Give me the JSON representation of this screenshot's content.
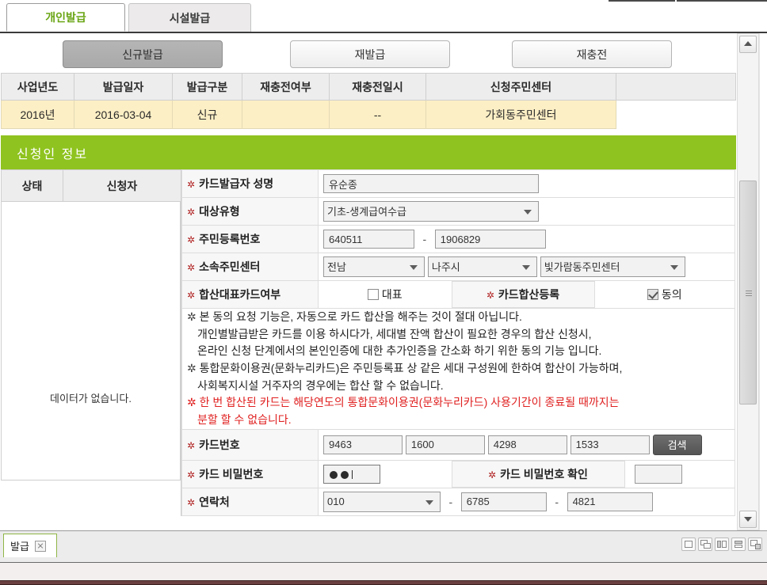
{
  "tabs": [
    {
      "label": "개인발급",
      "active": true
    },
    {
      "label": "시설발급",
      "active": false
    }
  ],
  "action_buttons": [
    {
      "label": "신규발급",
      "selected": true
    },
    {
      "label": "재발급",
      "selected": false
    },
    {
      "label": "재충전",
      "selected": false
    }
  ],
  "summary_grid": {
    "headers": [
      "사업년도",
      "발급일자",
      "발급구분",
      "재충전여부",
      "재충전일시",
      "신청주민센터",
      ""
    ],
    "rows": [
      [
        "2016년",
        "2016-03-04",
        "신규",
        "",
        "--",
        "가회동주민센터",
        ""
      ]
    ]
  },
  "section": {
    "title": "신청인 정보"
  },
  "left_list": {
    "headers": [
      "상태",
      "신청자"
    ],
    "empty_message": "데이터가 없습니다."
  },
  "form": {
    "name": {
      "label": "카드발급자 성명",
      "value": "유순종"
    },
    "target_type": {
      "label": "대상유형",
      "value": "기초-생계급여수급"
    },
    "resident_number": {
      "label": "주민등록번호",
      "front": "640511",
      "separator": "-",
      "back": "1906829"
    },
    "center": {
      "label": "소속주민센터",
      "province": "전남",
      "city": "나주시",
      "dong": "빛가람동주민센터"
    },
    "merge_rep": {
      "label": "합산대표카드여부",
      "checkbox_label": "대표",
      "checked": false
    },
    "merge_register": {
      "label": "카드합산등록",
      "checkbox_label": "동의",
      "checked": true
    },
    "notice": {
      "lines": [
        {
          "text": "본 동의 요청 기능은,  자동으로 카드 합산을 해주는 것이 절대 아닙니다.",
          "bullet": true,
          "red": false
        },
        {
          "text": "개인별발급받은 카드를 이용 하시다가, 세대별 잔액 합산이 필요한 경우의  합산 신청시,",
          "bullet": false,
          "red": false
        },
        {
          "text": "온라인 신청 단계에서의 본인인증에 대한 추가인증을 간소화 하기 위한 동의 기능 입니다.",
          "bullet": false,
          "red": false
        },
        {
          "text": "통합문화이용권(문화누리카드)은 주민등록표 상 같은 세대 구성원에 한하여 합산이 가능하며,",
          "bullet": true,
          "red": false
        },
        {
          "text": "사회복지시설 거주자의 경우에는 합산 할 수 없습니다.",
          "bullet": false,
          "red": false
        },
        {
          "text": "한 번 합산된 카드는 해당연도의 통합문화이용권(문화누리카드) 사용기간이 종료될 때까지는",
          "bullet": true,
          "red": true
        },
        {
          "text": "분할 할 수 없습니다.",
          "bullet": false,
          "red": true
        }
      ]
    },
    "card_number": {
      "label": "카드번호",
      "parts": [
        "9463",
        "1600",
        "4298",
        "1533"
      ],
      "search_button": "검색"
    },
    "card_password": {
      "label": "카드 비밀번호",
      "value": "••"
    },
    "card_password_confirm": {
      "label": "카드 비밀번호 확인",
      "value": ""
    },
    "phone": {
      "label": "연락처",
      "prefix": "010",
      "middle": "6785",
      "last": "4821",
      "separator": "-"
    }
  },
  "taskbar": {
    "item_label": "발급",
    "window_buttons": [
      "maximize-window-icon",
      "cascade-windows-icon",
      "tile-vertical-icon",
      "tile-horizontal-icon",
      "arrange-windows-icon"
    ]
  },
  "colors": {
    "accent_green": "#8fc31f",
    "tab_active_text": "#6aa515",
    "row_highlight": "#fdefc5",
    "warning_red": "#e02020",
    "taskbar_bg": "#ececec",
    "bottom_bar": "#6b4040"
  }
}
